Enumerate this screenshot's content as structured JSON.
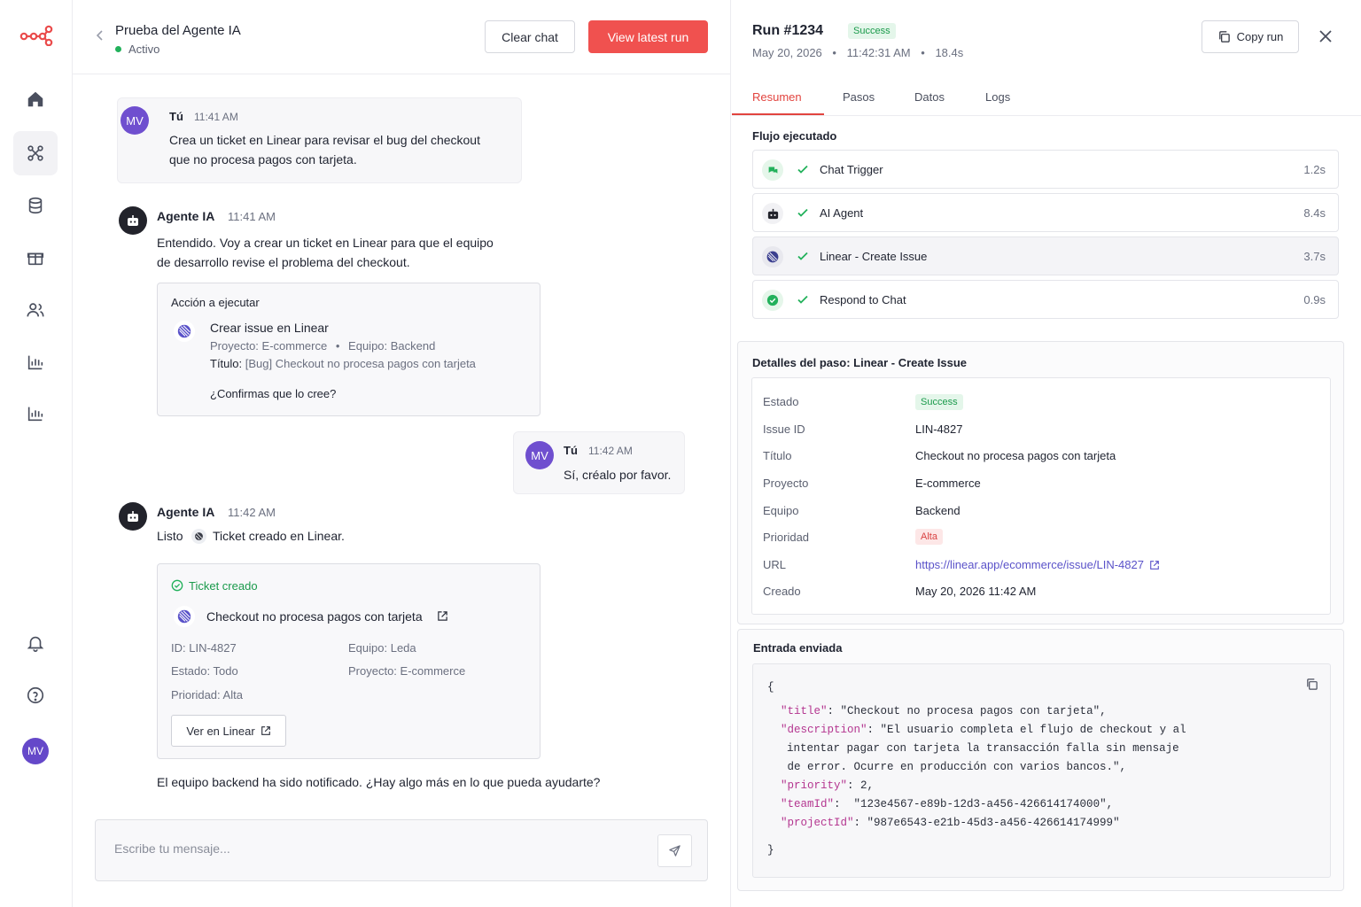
{
  "chat": {
    "title": "Prueba del Agente IA",
    "status": "Activo",
    "clear_label": "Clear chat",
    "view_run_label": "View latest run",
    "messages": {
      "m1": {
        "avatar": "MV",
        "sender": "Tú",
        "time": "11:41 AM",
        "line1": "Crea un ticket en Linear para revisar el bug del checkout",
        "line2": "que no procesa pagos con tarjeta."
      },
      "m2": {
        "sender": "Agente IA",
        "time": "11:41 AM",
        "line1": "Entendido. Voy a crear un ticket en Linear para que el equipo",
        "line2": "de desarrollo revise el problema del checkout."
      },
      "m3": {
        "avatar": "MV",
        "sender": "Tú",
        "time": "11:42 AM",
        "text": "Sí, créalo por favor."
      },
      "m4": {
        "sender": "Agente IA",
        "time": "11:42 AM",
        "prefix": "Listo",
        "text": "Ticket creado en Linear."
      },
      "m5": {
        "text": "El equipo backend ha sido notificado. ¿Hay algo más en lo que pueda ayudarte?"
      }
    },
    "action_card": {
      "label": "Acción a ejecutar",
      "title": "Crear issue en Linear",
      "proyecto_label": "Proyecto:",
      "proyecto": "E-commerce",
      "equipo_label": "Equipo:",
      "equipo": "Backend",
      "titulo_label": "Título:",
      "titulo": "[Bug] Checkout no procesa pagos con tarjeta",
      "confirm": "¿Confirmas que lo cree?"
    },
    "ticket_card": {
      "header": "Ticket creado",
      "title": "Checkout no procesa pagos con tarjeta",
      "id_label": "ID:",
      "id": "LIN-4827",
      "equipo_label": "Equipo:",
      "equipo": "Leda",
      "estado_label": "Estado:",
      "estado": "Todo",
      "proyecto_label": "Proyecto:",
      "proyecto": "E-commerce",
      "prioridad_label": "Prioridad:",
      "prioridad": "Alta",
      "button": "Ver en Linear"
    },
    "input_placeholder": "Escribe tu mensaje..."
  },
  "sidebar": {
    "avatar": "MV"
  },
  "run": {
    "title": "Run #1234",
    "status": "Success",
    "date": "May 20, 2026",
    "time": "11:42:31 AM",
    "duration": "18.4s",
    "copy_label": "Copy run",
    "tabs": [
      "Resumen",
      "Pasos",
      "Datos",
      "Logs"
    ],
    "flow_title": "Flujo ejecutado",
    "steps": [
      {
        "name": "Chat Trigger",
        "duration": "1.2s"
      },
      {
        "name": "AI Agent",
        "duration": "8.4s"
      },
      {
        "name": "Linear - Create Issue",
        "duration": "3.7s"
      },
      {
        "name": "Respond to Chat",
        "duration": "0.9s"
      }
    ],
    "details": {
      "title": "Detalles del paso: Linear - Create Issue",
      "rows": {
        "estado": {
          "k": "Estado",
          "v": "Success"
        },
        "issue": {
          "k": "Issue ID",
          "v": "LIN-4827"
        },
        "titulo": {
          "k": "Título",
          "v": "Checkout no procesa pagos con tarjeta"
        },
        "proyecto": {
          "k": "Proyecto",
          "v": "E-commerce"
        },
        "equipo": {
          "k": "Equipo",
          "v": "Backend"
        },
        "prioridad": {
          "k": "Prioridad",
          "v": "Alta"
        },
        "url": {
          "k": "URL",
          "v": "https://linear.app/ecommerce/issue/LIN-4827"
        },
        "creado": {
          "k": "Creado",
          "v": "May 20, 2026 11:42 AM"
        }
      }
    },
    "input": {
      "title": "Entrada enviada",
      "open": "{",
      "close": "}",
      "lines": [
        {
          "k": "\"title\"",
          "v": ": \"Checkout no procesa pagos con tarjeta\","
        },
        {
          "k": "\"description\"",
          "v": ": \"El usuario completa el flujo de checkout y al"
        },
        {
          "k": "",
          "v": "intentar pagar con tarjeta la transacción falla sin mensaje"
        },
        {
          "k": "",
          "v": " de error. Ocurre en producción con varios bancos.\","
        },
        {
          "k": "\"priority\"",
          "v": ": 2,"
        },
        {
          "k": "\"teamId\"",
          "v": ":  \"123e4567-e89b-12d3-a456-426614174000\","
        },
        {
          "k": "\"projectId\"",
          "v": ": \"987e6543-e21b-45d3-a456-426614174999\""
        }
      ]
    }
  },
  "colors": {
    "accent": "#f0514f",
    "success": "#22b15b",
    "linear": "#5a52c9",
    "avatar": "#6f4fcf"
  }
}
